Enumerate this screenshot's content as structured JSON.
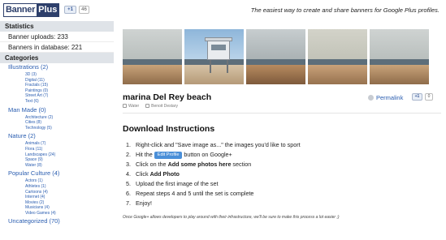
{
  "header": {
    "logo_part1": "Banner",
    "logo_part2": "Plus",
    "plus_label": "+1",
    "plus_count": "46",
    "tagline": "The easiest way to create and share banners for Google Plus profiles."
  },
  "sidebar": {
    "statistics_heading": "Statistics",
    "stats": [
      {
        "label": "Banner uploads: 233"
      },
      {
        "label": "Banners in database: 221"
      }
    ],
    "categories_heading": "Categories",
    "categories": [
      {
        "title": "Illustrations (2)",
        "subs": [
          "3D (3)",
          "Digital (11)",
          "Fractals (15)",
          "Paintings (0)",
          "Street Art (7)",
          "Text (6)"
        ]
      },
      {
        "title": "Man Made (0)",
        "subs": [
          "Architecture (2)",
          "Cities (8)",
          "Technology (5)"
        ]
      },
      {
        "title": "Nature (2)",
        "subs": [
          "Animals (7)",
          "Flora (11)",
          "Landscapes (24)",
          "Space (9)",
          "Water (8)"
        ]
      },
      {
        "title": "Popular Culture (4)",
        "subs": [
          "Actors (1)",
          "Athletes (1)",
          "Cartoons (4)",
          "Internet (4)",
          "Movies (2)",
          "Musicians (4)",
          "Video Games (4)"
        ]
      },
      {
        "title": "Uncategorized (70)",
        "subs": []
      }
    ]
  },
  "main": {
    "title": "marina Del Rey beach",
    "tags": [
      "Water",
      "Benoit Destary"
    ],
    "permalink": "Permalink",
    "plus_label": "+1",
    "plus_count": "0",
    "download_heading": "Download Instructions",
    "edit_profile_button": "Edit Profile",
    "steps": [
      {
        "num": "1.",
        "text": "Right-click and \"Save image as...\" the images you'd like to sport"
      },
      {
        "num": "2.",
        "pre": "Hit the ",
        "post": " button on Google+"
      },
      {
        "num": "3.",
        "pre": "Click on the ",
        "bold": "Add some photos here",
        "post": " section"
      },
      {
        "num": "4.",
        "pre": "Click ",
        "bold": "Add Photo",
        "post": ""
      },
      {
        "num": "5.",
        "text": "Upload the first image of the set"
      },
      {
        "num": "6.",
        "text": "Repeat steps 4 and 5 until the set is complete"
      },
      {
        "num": "7.",
        "text": "Enjoy!"
      }
    ],
    "note": "Once Google+ allows developers to play around with their infrastructure, we'll be sure to make this process a lot easier ;)"
  },
  "colors": {
    "link": "#2a5db0",
    "sidebar_header_bg": "#dfe3e8",
    "edit_button_bg": "#4a8fd8",
    "logo_dark": "#2d3f6b"
  }
}
